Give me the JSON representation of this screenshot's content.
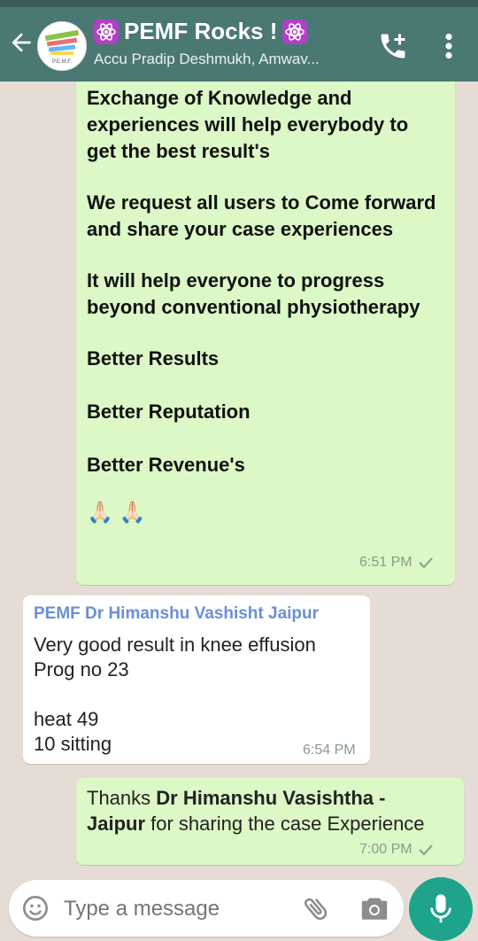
{
  "header": {
    "title": "PEMF Rocks !",
    "subtitle": "Accu Pradip Deshmukh, Amwav...",
    "avatar_text": "P.E.M.F."
  },
  "messages": {
    "m1": {
      "paragraphs": [
        "Exchange of Knowledge and experiences will help everybody to get the best result's",
        "We request all users to Come forward and share your case experiences",
        "It will help everyone to  progress beyond conventional physiotherapy",
        "Better Results",
        "Better Reputation",
        "Better Revenue's"
      ],
      "emojis": "🙏🏻 🙏🏻",
      "time": "6:51 PM"
    },
    "m2": {
      "sender": "PEMF Dr Himanshu Vashisht Jaipur",
      "lines": [
        "Very good result  in  knee effusion",
        "Prog no 23",
        "",
        "heat 49",
        "10 sitting"
      ],
      "time": "6:54 PM"
    },
    "m3": {
      "prefix": "Thanks ",
      "bold_name": "Dr Himanshu Vasishtha - Jaipur",
      "suffix": " for sharing the case Experience",
      "time": "7:00 PM"
    }
  },
  "composer": {
    "placeholder": "Type a message"
  },
  "colors": {
    "header": "#4a7873",
    "outgoing": "#dcf8c6",
    "incoming": "#ffffff",
    "sender_name": "#6b8fd6",
    "mic": "#1ea48a"
  },
  "icons": [
    "back-arrow-icon",
    "add-call-icon",
    "more-options-icon",
    "emoji-icon",
    "attach-icon",
    "camera-icon",
    "mic-icon",
    "read-check-icon"
  ]
}
